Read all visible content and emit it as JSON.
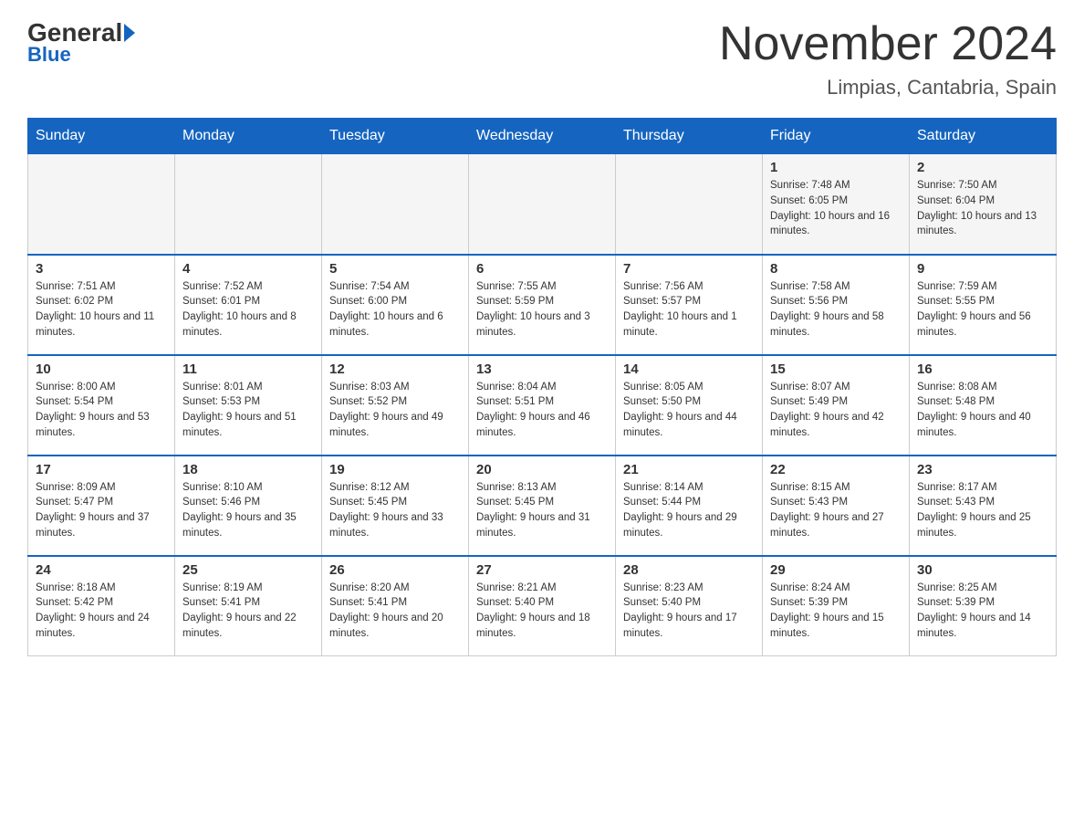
{
  "header": {
    "logo_general": "General",
    "logo_blue": "Blue",
    "month_title": "November 2024",
    "location": "Limpias, Cantabria, Spain"
  },
  "days_of_week": [
    "Sunday",
    "Monday",
    "Tuesday",
    "Wednesday",
    "Thursday",
    "Friday",
    "Saturday"
  ],
  "weeks": [
    [
      {
        "day": "",
        "sunrise": "",
        "sunset": "",
        "daylight": ""
      },
      {
        "day": "",
        "sunrise": "",
        "sunset": "",
        "daylight": ""
      },
      {
        "day": "",
        "sunrise": "",
        "sunset": "",
        "daylight": ""
      },
      {
        "day": "",
        "sunrise": "",
        "sunset": "",
        "daylight": ""
      },
      {
        "day": "",
        "sunrise": "",
        "sunset": "",
        "daylight": ""
      },
      {
        "day": "1",
        "sunrise": "Sunrise: 7:48 AM",
        "sunset": "Sunset: 6:05 PM",
        "daylight": "Daylight: 10 hours and 16 minutes."
      },
      {
        "day": "2",
        "sunrise": "Sunrise: 7:50 AM",
        "sunset": "Sunset: 6:04 PM",
        "daylight": "Daylight: 10 hours and 13 minutes."
      }
    ],
    [
      {
        "day": "3",
        "sunrise": "Sunrise: 7:51 AM",
        "sunset": "Sunset: 6:02 PM",
        "daylight": "Daylight: 10 hours and 11 minutes."
      },
      {
        "day": "4",
        "sunrise": "Sunrise: 7:52 AM",
        "sunset": "Sunset: 6:01 PM",
        "daylight": "Daylight: 10 hours and 8 minutes."
      },
      {
        "day": "5",
        "sunrise": "Sunrise: 7:54 AM",
        "sunset": "Sunset: 6:00 PM",
        "daylight": "Daylight: 10 hours and 6 minutes."
      },
      {
        "day": "6",
        "sunrise": "Sunrise: 7:55 AM",
        "sunset": "Sunset: 5:59 PM",
        "daylight": "Daylight: 10 hours and 3 minutes."
      },
      {
        "day": "7",
        "sunrise": "Sunrise: 7:56 AM",
        "sunset": "Sunset: 5:57 PM",
        "daylight": "Daylight: 10 hours and 1 minute."
      },
      {
        "day": "8",
        "sunrise": "Sunrise: 7:58 AM",
        "sunset": "Sunset: 5:56 PM",
        "daylight": "Daylight: 9 hours and 58 minutes."
      },
      {
        "day": "9",
        "sunrise": "Sunrise: 7:59 AM",
        "sunset": "Sunset: 5:55 PM",
        "daylight": "Daylight: 9 hours and 56 minutes."
      }
    ],
    [
      {
        "day": "10",
        "sunrise": "Sunrise: 8:00 AM",
        "sunset": "Sunset: 5:54 PM",
        "daylight": "Daylight: 9 hours and 53 minutes."
      },
      {
        "day": "11",
        "sunrise": "Sunrise: 8:01 AM",
        "sunset": "Sunset: 5:53 PM",
        "daylight": "Daylight: 9 hours and 51 minutes."
      },
      {
        "day": "12",
        "sunrise": "Sunrise: 8:03 AM",
        "sunset": "Sunset: 5:52 PM",
        "daylight": "Daylight: 9 hours and 49 minutes."
      },
      {
        "day": "13",
        "sunrise": "Sunrise: 8:04 AM",
        "sunset": "Sunset: 5:51 PM",
        "daylight": "Daylight: 9 hours and 46 minutes."
      },
      {
        "day": "14",
        "sunrise": "Sunrise: 8:05 AM",
        "sunset": "Sunset: 5:50 PM",
        "daylight": "Daylight: 9 hours and 44 minutes."
      },
      {
        "day": "15",
        "sunrise": "Sunrise: 8:07 AM",
        "sunset": "Sunset: 5:49 PM",
        "daylight": "Daylight: 9 hours and 42 minutes."
      },
      {
        "day": "16",
        "sunrise": "Sunrise: 8:08 AM",
        "sunset": "Sunset: 5:48 PM",
        "daylight": "Daylight: 9 hours and 40 minutes."
      }
    ],
    [
      {
        "day": "17",
        "sunrise": "Sunrise: 8:09 AM",
        "sunset": "Sunset: 5:47 PM",
        "daylight": "Daylight: 9 hours and 37 minutes."
      },
      {
        "day": "18",
        "sunrise": "Sunrise: 8:10 AM",
        "sunset": "Sunset: 5:46 PM",
        "daylight": "Daylight: 9 hours and 35 minutes."
      },
      {
        "day": "19",
        "sunrise": "Sunrise: 8:12 AM",
        "sunset": "Sunset: 5:45 PM",
        "daylight": "Daylight: 9 hours and 33 minutes."
      },
      {
        "day": "20",
        "sunrise": "Sunrise: 8:13 AM",
        "sunset": "Sunset: 5:45 PM",
        "daylight": "Daylight: 9 hours and 31 minutes."
      },
      {
        "day": "21",
        "sunrise": "Sunrise: 8:14 AM",
        "sunset": "Sunset: 5:44 PM",
        "daylight": "Daylight: 9 hours and 29 minutes."
      },
      {
        "day": "22",
        "sunrise": "Sunrise: 8:15 AM",
        "sunset": "Sunset: 5:43 PM",
        "daylight": "Daylight: 9 hours and 27 minutes."
      },
      {
        "day": "23",
        "sunrise": "Sunrise: 8:17 AM",
        "sunset": "Sunset: 5:43 PM",
        "daylight": "Daylight: 9 hours and 25 minutes."
      }
    ],
    [
      {
        "day": "24",
        "sunrise": "Sunrise: 8:18 AM",
        "sunset": "Sunset: 5:42 PM",
        "daylight": "Daylight: 9 hours and 24 minutes."
      },
      {
        "day": "25",
        "sunrise": "Sunrise: 8:19 AM",
        "sunset": "Sunset: 5:41 PM",
        "daylight": "Daylight: 9 hours and 22 minutes."
      },
      {
        "day": "26",
        "sunrise": "Sunrise: 8:20 AM",
        "sunset": "Sunset: 5:41 PM",
        "daylight": "Daylight: 9 hours and 20 minutes."
      },
      {
        "day": "27",
        "sunrise": "Sunrise: 8:21 AM",
        "sunset": "Sunset: 5:40 PM",
        "daylight": "Daylight: 9 hours and 18 minutes."
      },
      {
        "day": "28",
        "sunrise": "Sunrise: 8:23 AM",
        "sunset": "Sunset: 5:40 PM",
        "daylight": "Daylight: 9 hours and 17 minutes."
      },
      {
        "day": "29",
        "sunrise": "Sunrise: 8:24 AM",
        "sunset": "Sunset: 5:39 PM",
        "daylight": "Daylight: 9 hours and 15 minutes."
      },
      {
        "day": "30",
        "sunrise": "Sunrise: 8:25 AM",
        "sunset": "Sunset: 5:39 PM",
        "daylight": "Daylight: 9 hours and 14 minutes."
      }
    ]
  ]
}
